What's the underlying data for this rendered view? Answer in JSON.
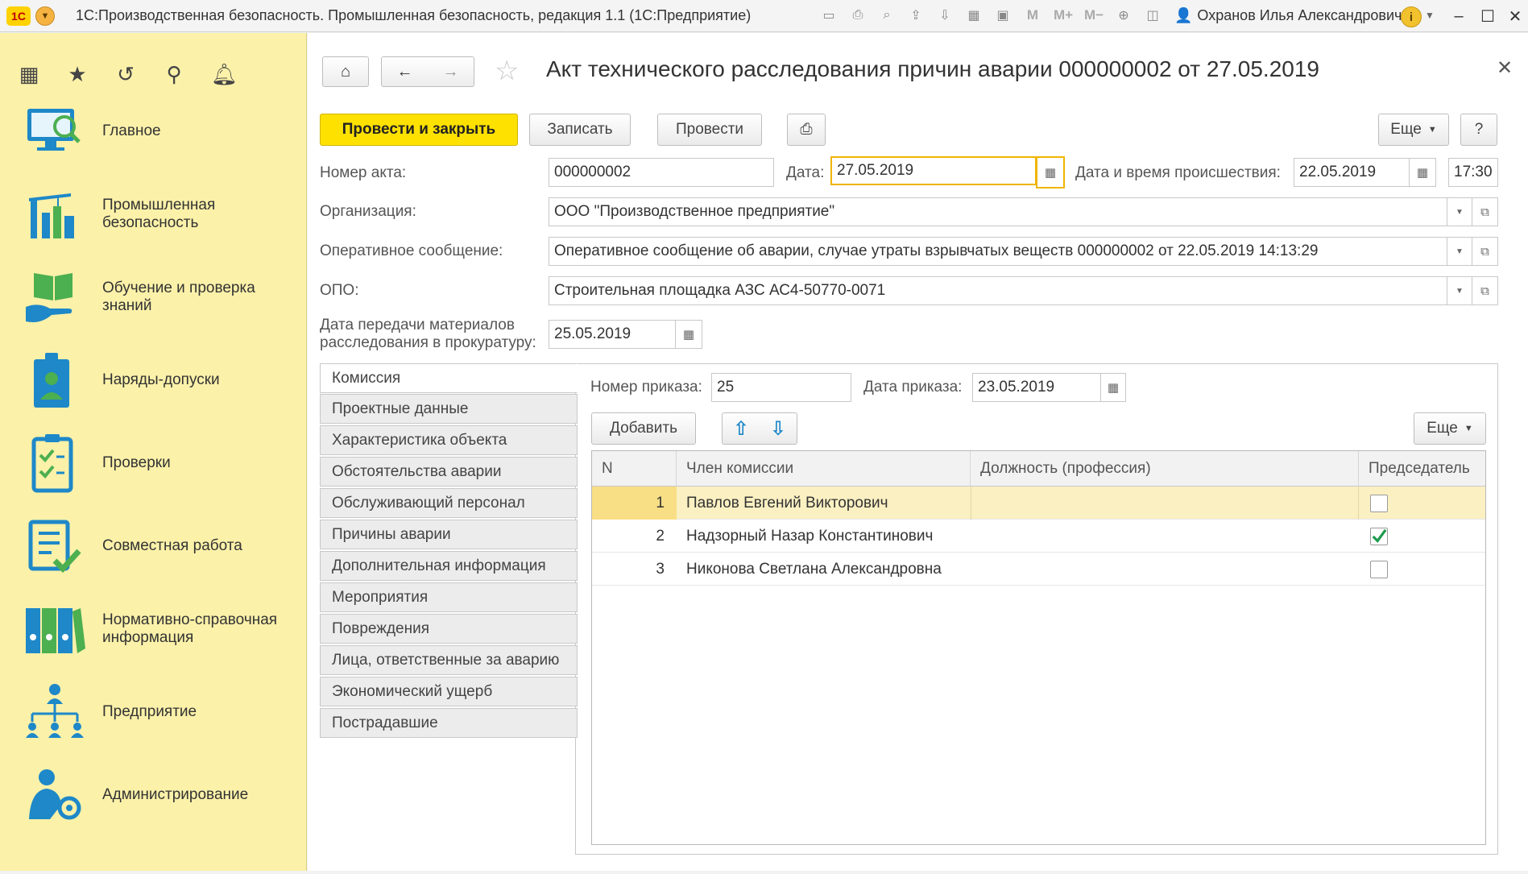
{
  "app": {
    "title": "1С:Производственная безопасность. Промышленная безопасность, редакция 1.1  (1С:Предприятие)",
    "logo": "1С",
    "user": "Охранов Илья Александрович"
  },
  "sidebar": {
    "items": [
      {
        "label": "Главное",
        "icon": "monitor-search-icon"
      },
      {
        "label": "Промышленная безопасность",
        "icon": "industrial-plant-icon"
      },
      {
        "label": "Обучение и проверка знаний",
        "icon": "book-hand-icon"
      },
      {
        "label": "Наряды-допуски",
        "icon": "badge-person-icon"
      },
      {
        "label": "Проверки",
        "icon": "checklist-icon"
      },
      {
        "label": "Совместная работа",
        "icon": "document-check-icon"
      },
      {
        "label": "Нормативно-справочная информация",
        "icon": "binders-icon"
      },
      {
        "label": "Предприятие",
        "icon": "org-structure-icon"
      },
      {
        "label": "Администрирование",
        "icon": "admin-gear-icon"
      }
    ]
  },
  "form": {
    "title": "Акт технического расследования причин аварии 000000002 от 27.05.2019",
    "buttons": {
      "post_close": "Провести и закрыть",
      "save": "Записать",
      "post": "Провести",
      "more": "Еще",
      "help": "?"
    },
    "fields": {
      "act_number_label": "Номер акта:",
      "act_number": "000000002",
      "date_label": "Дата:",
      "date": "27.05.2019",
      "incident_label": "Дата и время происшествия:",
      "incident_date": "22.05.2019",
      "incident_time": "17:30",
      "org_label": "Организация:",
      "org": "ООО \"Производственное предприятие\"",
      "report_label": "Оперативное сообщение:",
      "report": "Оперативное сообщение об аварии, случае утраты взрывчатых веществ 000000002 от 22.05.2019 14:13:29",
      "opo_label": "ОПО:",
      "opo": "Строительная площадка АЗС АС4-50770-0071",
      "prosecutor_label_1": "Дата передачи материалов",
      "prosecutor_label_2": "расследования в прокуратуру:",
      "prosecutor_date": "25.05.2019"
    },
    "tabs": [
      "Комиссия",
      "Проектные данные",
      "Характеристика объекта",
      "Обстоятельства аварии",
      "Обслуживающий персонал",
      "Причины аварии",
      "Дополнительная информация",
      "Мероприятия",
      "Повреждения",
      "Лица, ответственные за аварию",
      "Экономический ущерб",
      "Пострадавшие"
    ],
    "commission": {
      "order_number_label": "Номер приказа:",
      "order_number": "25",
      "order_date_label": "Дата приказа:",
      "order_date": "23.05.2019",
      "add_button": "Добавить",
      "more_button": "Еще",
      "columns": [
        "N",
        "Член комиссии",
        "Должность (профессия)",
        "Председатель"
      ],
      "rows": [
        {
          "n": "1",
          "member": "Павлов Евгений Викторович",
          "position": "",
          "chairman": false
        },
        {
          "n": "2",
          "member": "Надзорный Назар Константинович",
          "position": "",
          "chairman": true
        },
        {
          "n": "3",
          "member": "Никонова Светлана Александровна",
          "position": "",
          "chairman": false
        }
      ]
    }
  }
}
